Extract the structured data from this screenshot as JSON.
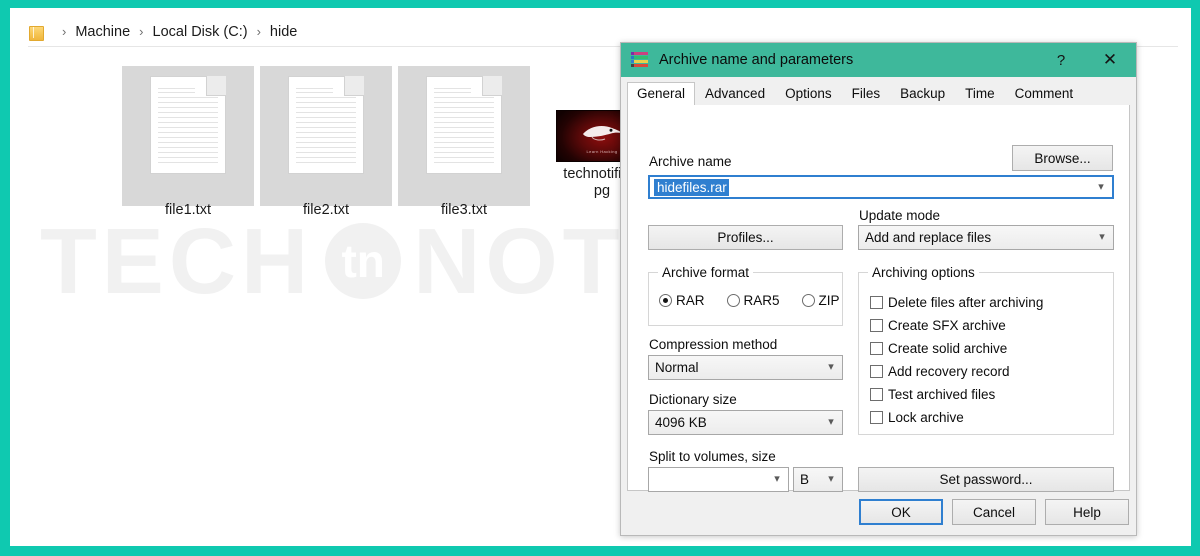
{
  "theme": {
    "frame_color": "#0FC9B0",
    "titlebar_color": "#3EB89B",
    "accent_blue": "#2f7fd0",
    "selection_blue": "#2f7fd0"
  },
  "watermark": {
    "text_left": "TECH",
    "badge": "tn",
    "text_right": "NOTIFICATION"
  },
  "explorer": {
    "breadcrumb": {
      "folder_icon": "folder-icon",
      "separator": "›",
      "items": [
        {
          "label": "Machine"
        },
        {
          "label": "Local Disk (C:)"
        },
        {
          "label": "hide"
        }
      ]
    },
    "files": [
      {
        "name": "file1.txt",
        "kind": "text-document",
        "selected": true
      },
      {
        "name": "file2.txt",
        "kind": "text-document",
        "selected": true
      },
      {
        "name": "file3.txt",
        "kind": "text-document",
        "selected": true
      },
      {
        "name": "technotificat…pg",
        "name_line1": "technotificat",
        "name_line2": "pg",
        "kind": "image",
        "thumb_caption": "Learn Hacking",
        "selected": false
      }
    ]
  },
  "dialog": {
    "title": "Archive name and parameters",
    "icon": "winrar-books-icon",
    "titlebar_buttons": [
      {
        "name": "help-button",
        "glyph": "?"
      },
      {
        "name": "close-button",
        "glyph": "✕"
      }
    ],
    "tabs": [
      {
        "label": "General",
        "active": true
      },
      {
        "label": "Advanced",
        "active": false
      },
      {
        "label": "Options",
        "active": false
      },
      {
        "label": "Files",
        "active": false
      },
      {
        "label": "Backup",
        "active": false
      },
      {
        "label": "Time",
        "active": false
      },
      {
        "label": "Comment",
        "active": false
      }
    ],
    "archive_name": {
      "label": "Archive name",
      "value": "hidefiles.rar",
      "selected": true,
      "browse_label": "Browse..."
    },
    "profiles_label": "Profiles...",
    "update_mode": {
      "label": "Update mode",
      "value": "Add and replace files"
    },
    "archive_format": {
      "legend": "Archive format",
      "options": [
        {
          "label": "RAR",
          "checked": true
        },
        {
          "label": "RAR5",
          "checked": false
        },
        {
          "label": "ZIP",
          "checked": false
        }
      ]
    },
    "compression_method": {
      "label": "Compression method",
      "value": "Normal"
    },
    "dictionary_size": {
      "label": "Dictionary size",
      "value": "4096 KB"
    },
    "split_volumes": {
      "label": "Split to volumes, size",
      "value": "",
      "unit": "B"
    },
    "archiving_options": {
      "legend": "Archiving options",
      "items": [
        {
          "label": "Delete files after archiving",
          "checked": false
        },
        {
          "label": "Create SFX archive",
          "checked": false
        },
        {
          "label": "Create solid archive",
          "checked": false
        },
        {
          "label": "Add recovery record",
          "checked": false
        },
        {
          "label": "Test archived files",
          "checked": false
        },
        {
          "label": "Lock archive",
          "checked": false
        }
      ]
    },
    "set_password_label": "Set password...",
    "footer": {
      "ok": "OK",
      "cancel": "Cancel",
      "help": "Help"
    }
  }
}
